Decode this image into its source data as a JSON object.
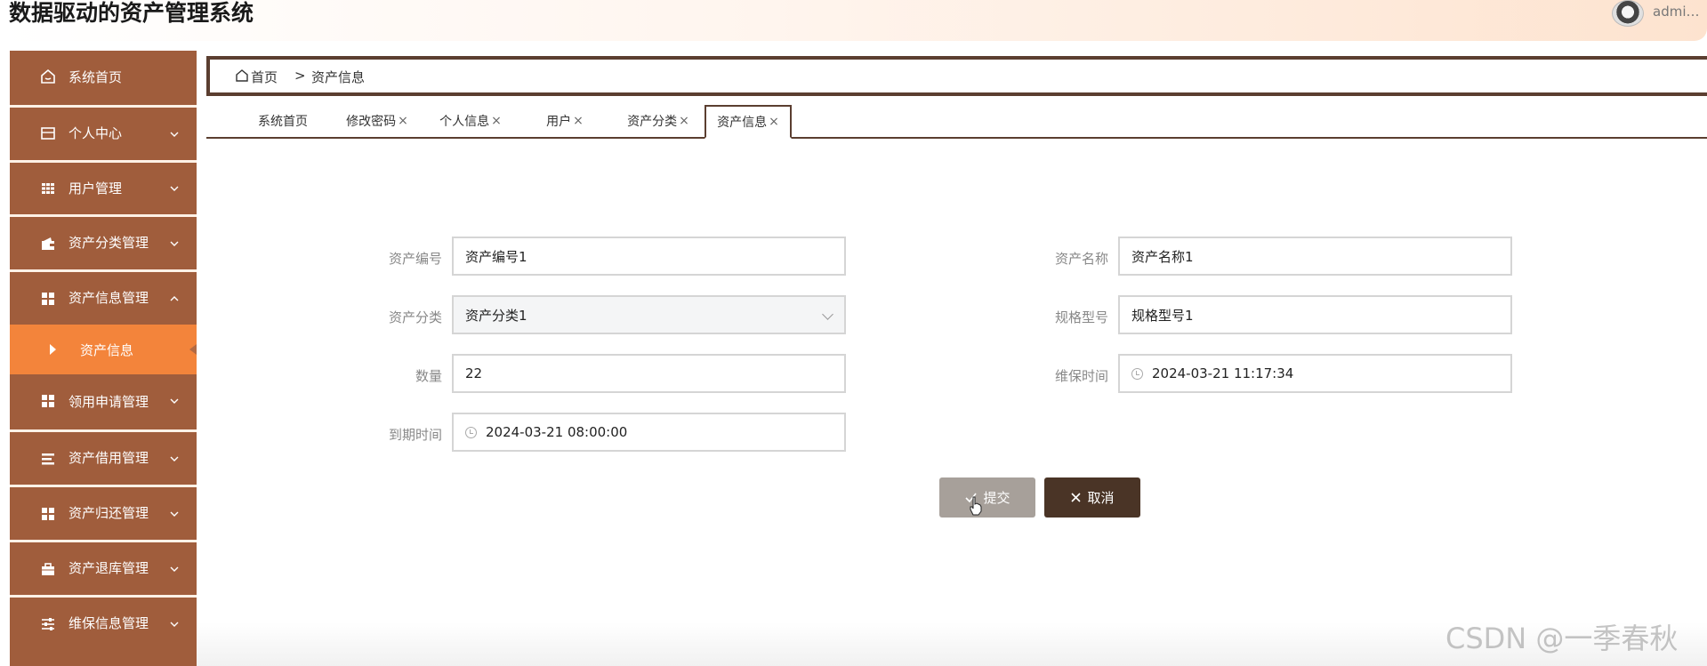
{
  "header": {
    "title": "数据驱动的资产管理系统",
    "user": "admi…"
  },
  "sidebar": {
    "items": [
      {
        "label": "系统首页",
        "icon": "home-icon"
      },
      {
        "label": "个人中心",
        "icon": "card-icon"
      },
      {
        "label": "用户管理",
        "icon": "grid-icon"
      },
      {
        "label": "资产分类管理",
        "icon": "wallet-icon"
      },
      {
        "label": "资产信息管理",
        "icon": "blocks-icon"
      },
      {
        "label": "领用申请管理",
        "icon": "blocks-icon"
      },
      {
        "label": "资产借用管理",
        "icon": "list-icon"
      },
      {
        "label": "资产归还管理",
        "icon": "blocks-icon"
      },
      {
        "label": "资产退库管理",
        "icon": "briefcase-icon"
      },
      {
        "label": "维保信息管理",
        "icon": "sliders-icon"
      }
    ],
    "active_sub": {
      "label": "资产信息"
    }
  },
  "breadcrumb": {
    "home": "首页",
    "separator": ">",
    "current": "资产信息"
  },
  "tabs": [
    {
      "label": "系统首页",
      "closable": false
    },
    {
      "label": "修改密码",
      "closable": true
    },
    {
      "label": "个人信息",
      "closable": true
    },
    {
      "label": "用户",
      "closable": true
    },
    {
      "label": "资产分类",
      "closable": true
    },
    {
      "label": "资产信息",
      "closable": true,
      "active": true
    }
  ],
  "tab_close_glyph": "×",
  "form": {
    "asset_code": {
      "label": "资产编号",
      "value": "资产编号1"
    },
    "asset_name": {
      "label": "资产名称",
      "value": "资产名称1"
    },
    "asset_category": {
      "label": "资产分类",
      "value": "资产分类1"
    },
    "spec_model": {
      "label": "规格型号",
      "value": "规格型号1"
    },
    "quantity": {
      "label": "数量",
      "value": "22"
    },
    "maintenance_time": {
      "label": "维保时间",
      "value": "2024-03-21 11:17:34"
    },
    "expiry_time": {
      "label": "到期时间",
      "value": "2024-03-21 08:00:00"
    }
  },
  "buttons": {
    "submit": "提交",
    "cancel": "取消"
  },
  "watermark": "CSDN @一季春秋",
  "colors": {
    "sidebar": "#a05d3c",
    "active_sub": "#f3843b",
    "dark_brown": "#5b3e30",
    "cancel_btn": "#4a3426",
    "submit_btn": "#a7a09a"
  }
}
